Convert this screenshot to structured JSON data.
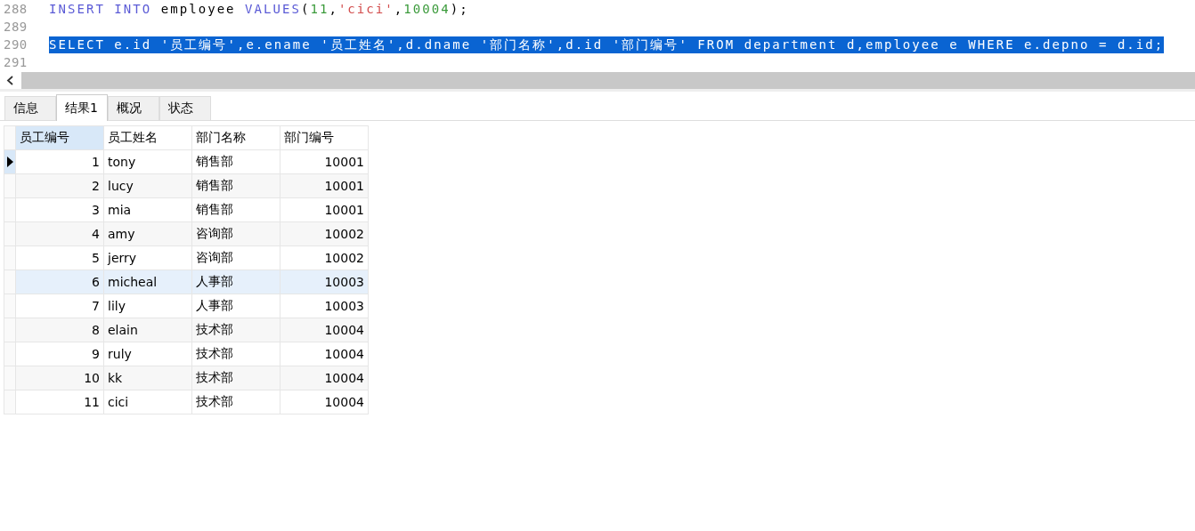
{
  "editor": {
    "lines": [
      {
        "number": "288",
        "selected": false,
        "tokens": [
          {
            "kind": "keyword",
            "text": "INSERT INTO"
          },
          {
            "kind": "ident",
            "text": " employee "
          },
          {
            "kind": "keyword",
            "text": "VALUES"
          },
          {
            "kind": "ident",
            "text": "("
          },
          {
            "kind": "number",
            "text": "11"
          },
          {
            "kind": "ident",
            "text": ","
          },
          {
            "kind": "string",
            "text": "'cici'"
          },
          {
            "kind": "ident",
            "text": ","
          },
          {
            "kind": "number",
            "text": "10004"
          },
          {
            "kind": "ident",
            "text": ");"
          }
        ]
      },
      {
        "number": "289",
        "selected": false
      },
      {
        "number": "290",
        "selected": true,
        "tokens": [
          {
            "kind": "ident",
            "text": "SELECT e.id '员工编号',e.ename '员工姓名',d.dname '部门名称',d.id '部门编号' FROM department d,employee e WHERE e.depno = d.id;"
          }
        ]
      },
      {
        "number": "291",
        "selected": false
      }
    ]
  },
  "result_tabs": [
    {
      "label": "信息",
      "selected": false
    },
    {
      "label": "结果1",
      "selected": true
    },
    {
      "label": "概况",
      "selected": false
    },
    {
      "label": "状态",
      "selected": false
    }
  ],
  "table": {
    "columns": [
      {
        "label": "员工编号",
        "selected": true
      },
      {
        "label": "员工姓名",
        "selected": false
      },
      {
        "label": "部门名称",
        "selected": false
      },
      {
        "label": "部门编号",
        "selected": false
      }
    ],
    "rows": [
      {
        "current": true,
        "highlighted": false,
        "cells": [
          "1",
          "tony",
          "销售部",
          "10001"
        ]
      },
      {
        "current": false,
        "highlighted": false,
        "cells": [
          "2",
          "lucy",
          "销售部",
          "10001"
        ]
      },
      {
        "current": false,
        "highlighted": false,
        "cells": [
          "3",
          "mia",
          "销售部",
          "10001"
        ]
      },
      {
        "current": false,
        "highlighted": false,
        "cells": [
          "4",
          "amy",
          "咨询部",
          "10002"
        ]
      },
      {
        "current": false,
        "highlighted": false,
        "cells": [
          "5",
          "jerry",
          "咨询部",
          "10002"
        ]
      },
      {
        "current": false,
        "highlighted": true,
        "cells": [
          "6",
          "micheal",
          "人事部",
          "10003"
        ]
      },
      {
        "current": false,
        "highlighted": false,
        "cells": [
          "7",
          "lily",
          "人事部",
          "10003"
        ]
      },
      {
        "current": false,
        "highlighted": false,
        "cells": [
          "8",
          "elain",
          "技术部",
          "10004"
        ]
      },
      {
        "current": false,
        "highlighted": false,
        "cells": [
          "9",
          "ruly",
          "技术部",
          "10004"
        ]
      },
      {
        "current": false,
        "highlighted": false,
        "cells": [
          "10",
          "kk",
          "技术部",
          "10004"
        ]
      },
      {
        "current": false,
        "highlighted": false,
        "cells": [
          "11",
          "cici",
          "技术部",
          "10004"
        ]
      }
    ]
  }
}
